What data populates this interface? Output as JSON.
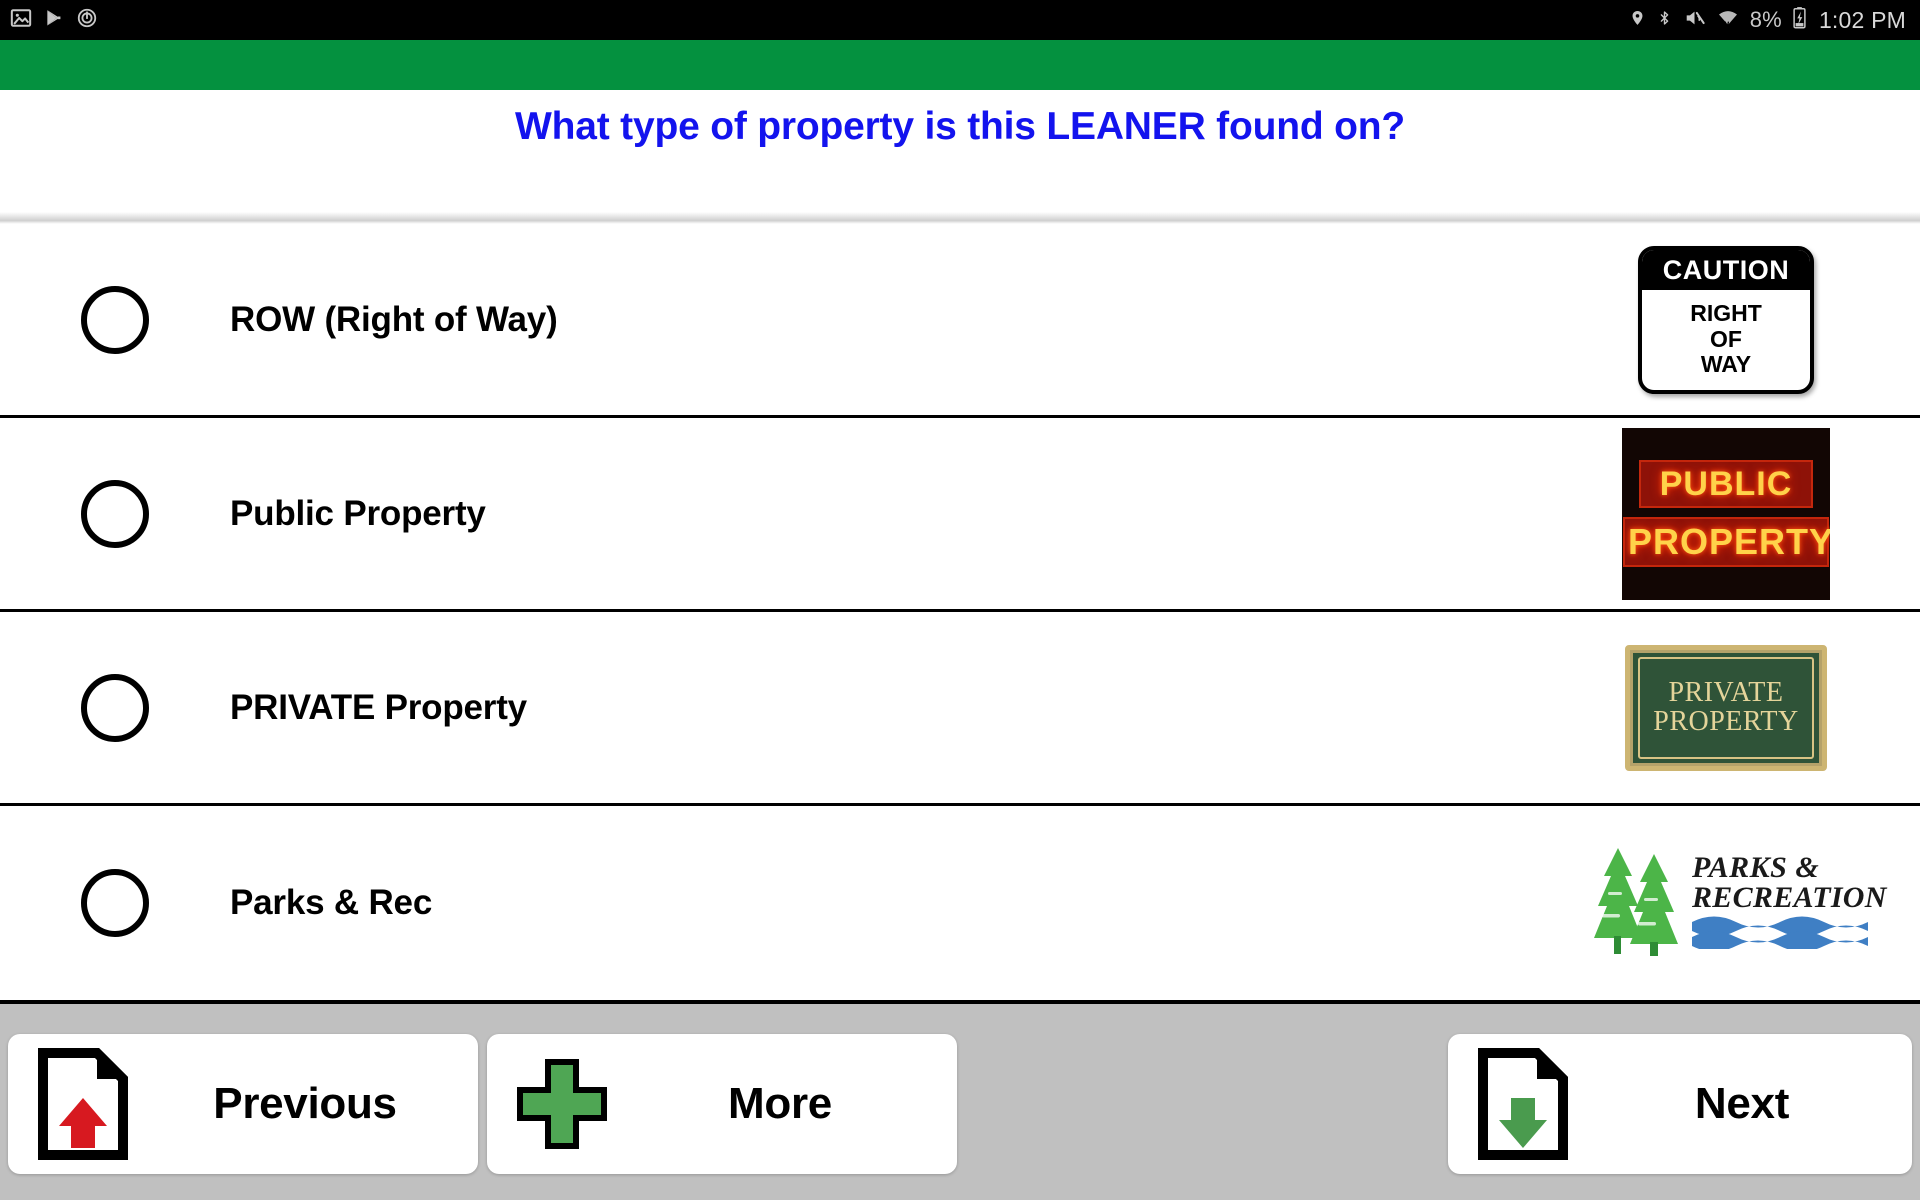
{
  "status_bar": {
    "left_icons": [
      "image-icon",
      "play-store-icon",
      "power-timer-icon"
    ],
    "right_icons": [
      "location-pin-icon",
      "bluetooth-icon",
      "volume-muted-icon",
      "wifi-icon"
    ],
    "battery_percent": "8%",
    "battery_icon": "battery-icon",
    "clock": "1:02 PM"
  },
  "theme": {
    "accent_green": "#04913f",
    "question_blue": "#1313ee",
    "bottom_bar_gray": "#c0c0c0"
  },
  "header": {
    "question": "What type of property is this LEANER found on?"
  },
  "options": [
    {
      "label": "ROW (Right of Way)",
      "selected": false,
      "art": {
        "type": "caution-sign",
        "top_text": "CAUTION",
        "lines": [
          "RIGHT",
          "OF",
          "WAY"
        ]
      }
    },
    {
      "label": "Public Property",
      "selected": false,
      "art": {
        "type": "neon-sign",
        "lines": [
          "PUBLIC",
          "PROPERTY"
        ]
      }
    },
    {
      "label": "PRIVATE Property",
      "selected": false,
      "art": {
        "type": "plaque-sign",
        "lines": [
          "PRIVATE",
          "PROPERTY"
        ]
      }
    },
    {
      "label": "Parks & Rec",
      "selected": false,
      "art": {
        "type": "parks-rec-logo",
        "lines": [
          "PARKS &",
          "RECREATION"
        ]
      }
    }
  ],
  "bottom_bar": {
    "previous_label": "Previous",
    "more_label": "More",
    "next_label": "Next",
    "previous_icon": "document-up-arrow-icon",
    "more_icon": "green-plus-icon",
    "next_icon": "document-down-arrow-icon"
  }
}
